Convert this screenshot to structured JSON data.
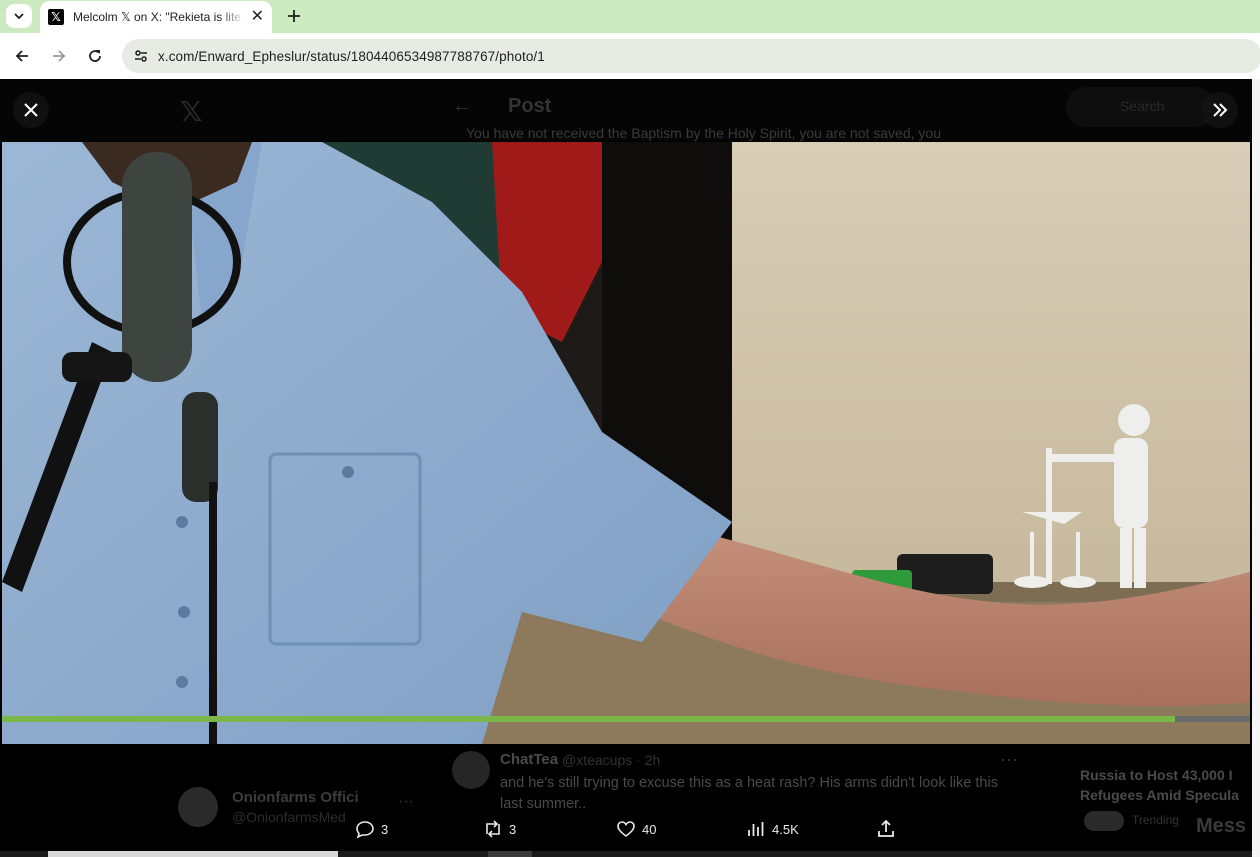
{
  "browser": {
    "tab_title": "Melcolm 𝕏 on X: \"Rekieta is lite",
    "url": "x.com/Enward_Epheslur/status/1804406534987788767/photo/1"
  },
  "background": {
    "header_title": "Post",
    "search_placeholder": "Search",
    "top_text": "You have not received the Baptism by the Holy Spirit, you are not saved, you",
    "reply": {
      "name": "ChatTea",
      "handle": "@xteacups · 2h",
      "text": "and he's still trying to excuse this as a heat rash? His arms didn't look like this last summer.."
    },
    "side_user": {
      "name": "Onionfarms Offici",
      "handle": "@OnionfarmsMed"
    },
    "news": {
      "line1": "Russia to Host 43,000 I",
      "line2": "Refugees Amid Specula",
      "line3": "Trending"
    },
    "messages_label": "Mess"
  },
  "media": {
    "progress": 0.94
  },
  "actions": {
    "replies": "3",
    "reposts": "3",
    "likes": "40",
    "views": "4.5K"
  },
  "colors": {
    "progress": "#7ab648",
    "tabbar": "#cbeac0"
  }
}
